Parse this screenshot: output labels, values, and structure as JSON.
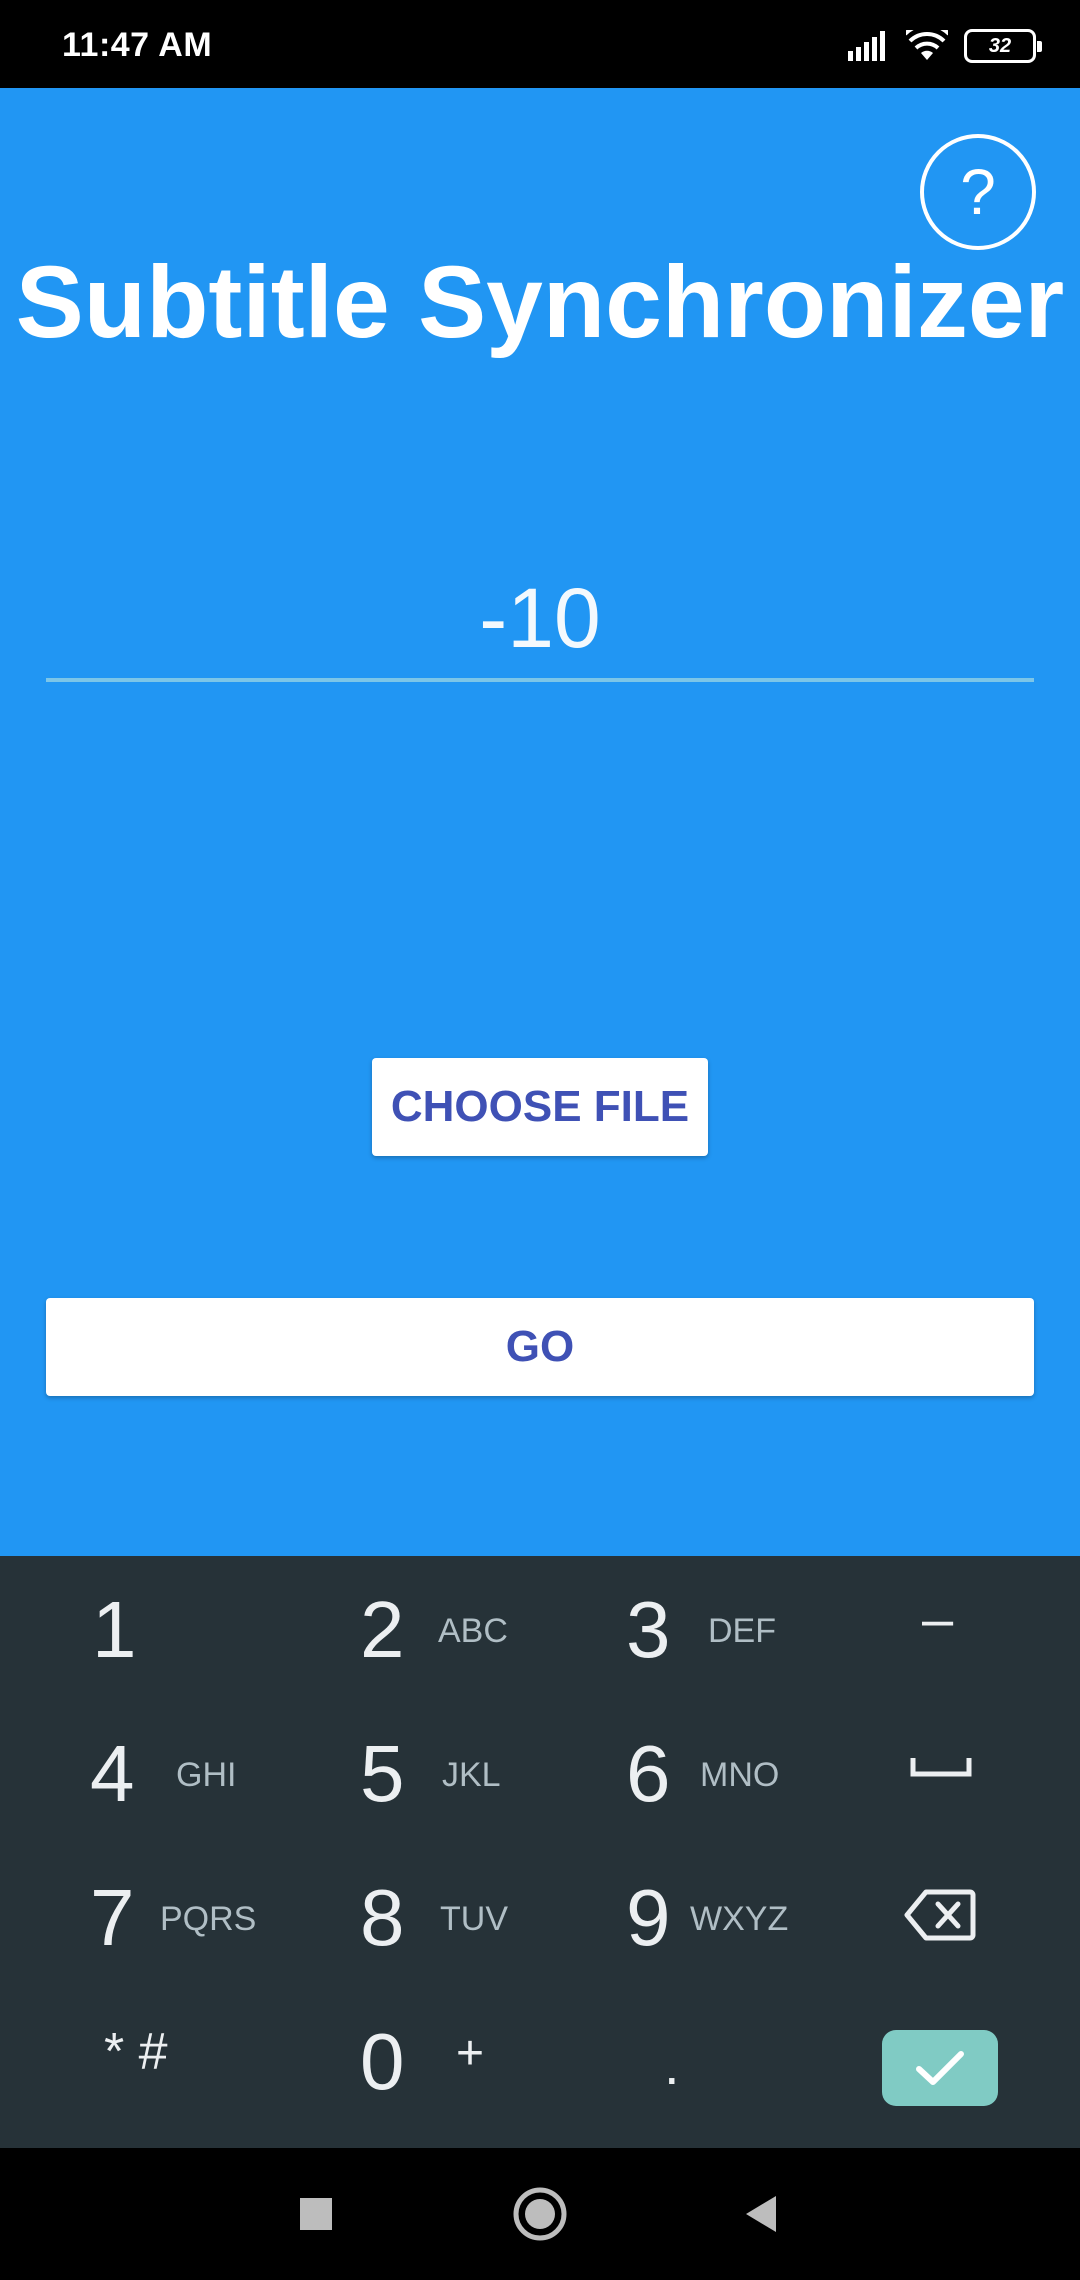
{
  "status_bar": {
    "time": "11:47 AM",
    "battery": "32",
    "icons": [
      "signal-icon",
      "wifi-icon",
      "battery-icon"
    ]
  },
  "app": {
    "title": "Subtitle Synchronizer",
    "help_label": "?",
    "offset_value": "-10",
    "choose_file_label": "CHOOSE FILE",
    "go_label": "GO",
    "colors": {
      "background": "#2196F3",
      "button_text": "#3F51B5",
      "underline": "#7cc6e8"
    }
  },
  "keyboard": {
    "row1": {
      "k1": "1",
      "k2": "2",
      "k2_letters": "ABC",
      "k3": "3",
      "k3_letters": "DEF",
      "k4": "–"
    },
    "row2": {
      "k1": "4",
      "k1_letters": "GHI",
      "k2": "5",
      "k2_letters": "JKL",
      "k3": "6",
      "k3_letters": "MNO",
      "k4_icon": "space-icon"
    },
    "row3": {
      "k1": "7",
      "k1_letters": "PQRS",
      "k2": "8",
      "k2_letters": "TUV",
      "k3": "9",
      "k3_letters": "WXYZ",
      "k4_icon": "backspace-icon"
    },
    "row4": {
      "k1": "* #",
      "k2": "0",
      "k2_extra": "+",
      "k3": ".",
      "k4_icon": "check-icon"
    },
    "colors": {
      "background": "#263238",
      "check": "#80cbc4"
    }
  },
  "nav_bar": {
    "icons": [
      "recent-apps-icon",
      "home-icon",
      "back-icon"
    ]
  }
}
